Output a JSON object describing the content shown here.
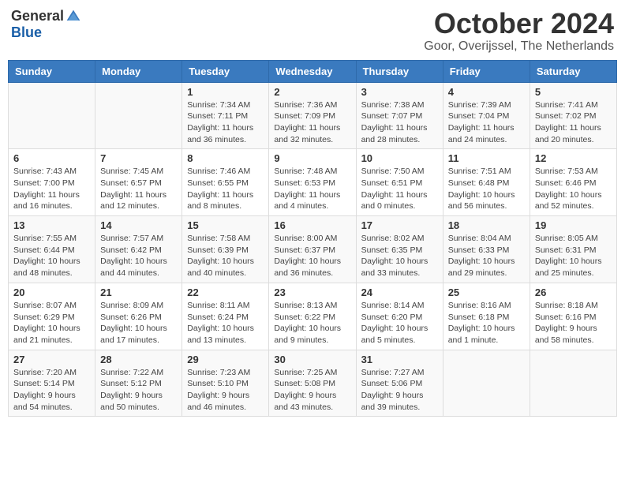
{
  "header": {
    "logo_general": "General",
    "logo_blue": "Blue",
    "title": "October 2024",
    "location": "Goor, Overijssel, The Netherlands"
  },
  "days_of_week": [
    "Sunday",
    "Monday",
    "Tuesday",
    "Wednesday",
    "Thursday",
    "Friday",
    "Saturday"
  ],
  "weeks": [
    [
      {
        "day": "",
        "info": ""
      },
      {
        "day": "",
        "info": ""
      },
      {
        "day": "1",
        "info": "Sunrise: 7:34 AM\nSunset: 7:11 PM\nDaylight: 11 hours\nand 36 minutes."
      },
      {
        "day": "2",
        "info": "Sunrise: 7:36 AM\nSunset: 7:09 PM\nDaylight: 11 hours\nand 32 minutes."
      },
      {
        "day": "3",
        "info": "Sunrise: 7:38 AM\nSunset: 7:07 PM\nDaylight: 11 hours\nand 28 minutes."
      },
      {
        "day": "4",
        "info": "Sunrise: 7:39 AM\nSunset: 7:04 PM\nDaylight: 11 hours\nand 24 minutes."
      },
      {
        "day": "5",
        "info": "Sunrise: 7:41 AM\nSunset: 7:02 PM\nDaylight: 11 hours\nand 20 minutes."
      }
    ],
    [
      {
        "day": "6",
        "info": "Sunrise: 7:43 AM\nSunset: 7:00 PM\nDaylight: 11 hours\nand 16 minutes."
      },
      {
        "day": "7",
        "info": "Sunrise: 7:45 AM\nSunset: 6:57 PM\nDaylight: 11 hours\nand 12 minutes."
      },
      {
        "day": "8",
        "info": "Sunrise: 7:46 AM\nSunset: 6:55 PM\nDaylight: 11 hours\nand 8 minutes."
      },
      {
        "day": "9",
        "info": "Sunrise: 7:48 AM\nSunset: 6:53 PM\nDaylight: 11 hours\nand 4 minutes."
      },
      {
        "day": "10",
        "info": "Sunrise: 7:50 AM\nSunset: 6:51 PM\nDaylight: 11 hours\nand 0 minutes."
      },
      {
        "day": "11",
        "info": "Sunrise: 7:51 AM\nSunset: 6:48 PM\nDaylight: 10 hours\nand 56 minutes."
      },
      {
        "day": "12",
        "info": "Sunrise: 7:53 AM\nSunset: 6:46 PM\nDaylight: 10 hours\nand 52 minutes."
      }
    ],
    [
      {
        "day": "13",
        "info": "Sunrise: 7:55 AM\nSunset: 6:44 PM\nDaylight: 10 hours\nand 48 minutes."
      },
      {
        "day": "14",
        "info": "Sunrise: 7:57 AM\nSunset: 6:42 PM\nDaylight: 10 hours\nand 44 minutes."
      },
      {
        "day": "15",
        "info": "Sunrise: 7:58 AM\nSunset: 6:39 PM\nDaylight: 10 hours\nand 40 minutes."
      },
      {
        "day": "16",
        "info": "Sunrise: 8:00 AM\nSunset: 6:37 PM\nDaylight: 10 hours\nand 36 minutes."
      },
      {
        "day": "17",
        "info": "Sunrise: 8:02 AM\nSunset: 6:35 PM\nDaylight: 10 hours\nand 33 minutes."
      },
      {
        "day": "18",
        "info": "Sunrise: 8:04 AM\nSunset: 6:33 PM\nDaylight: 10 hours\nand 29 minutes."
      },
      {
        "day": "19",
        "info": "Sunrise: 8:05 AM\nSunset: 6:31 PM\nDaylight: 10 hours\nand 25 minutes."
      }
    ],
    [
      {
        "day": "20",
        "info": "Sunrise: 8:07 AM\nSunset: 6:29 PM\nDaylight: 10 hours\nand 21 minutes."
      },
      {
        "day": "21",
        "info": "Sunrise: 8:09 AM\nSunset: 6:26 PM\nDaylight: 10 hours\nand 17 minutes."
      },
      {
        "day": "22",
        "info": "Sunrise: 8:11 AM\nSunset: 6:24 PM\nDaylight: 10 hours\nand 13 minutes."
      },
      {
        "day": "23",
        "info": "Sunrise: 8:13 AM\nSunset: 6:22 PM\nDaylight: 10 hours\nand 9 minutes."
      },
      {
        "day": "24",
        "info": "Sunrise: 8:14 AM\nSunset: 6:20 PM\nDaylight: 10 hours\nand 5 minutes."
      },
      {
        "day": "25",
        "info": "Sunrise: 8:16 AM\nSunset: 6:18 PM\nDaylight: 10 hours\nand 1 minute."
      },
      {
        "day": "26",
        "info": "Sunrise: 8:18 AM\nSunset: 6:16 PM\nDaylight: 9 hours\nand 58 minutes."
      }
    ],
    [
      {
        "day": "27",
        "info": "Sunrise: 7:20 AM\nSunset: 5:14 PM\nDaylight: 9 hours\nand 54 minutes."
      },
      {
        "day": "28",
        "info": "Sunrise: 7:22 AM\nSunset: 5:12 PM\nDaylight: 9 hours\nand 50 minutes."
      },
      {
        "day": "29",
        "info": "Sunrise: 7:23 AM\nSunset: 5:10 PM\nDaylight: 9 hours\nand 46 minutes."
      },
      {
        "day": "30",
        "info": "Sunrise: 7:25 AM\nSunset: 5:08 PM\nDaylight: 9 hours\nand 43 minutes."
      },
      {
        "day": "31",
        "info": "Sunrise: 7:27 AM\nSunset: 5:06 PM\nDaylight: 9 hours\nand 39 minutes."
      },
      {
        "day": "",
        "info": ""
      },
      {
        "day": "",
        "info": ""
      }
    ]
  ]
}
